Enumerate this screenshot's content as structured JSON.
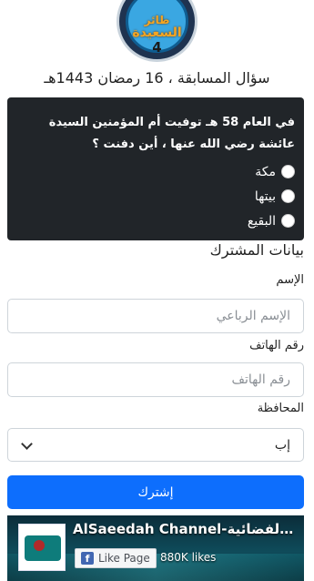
{
  "logo": {
    "line1": "طائر",
    "line2": "السعيدة",
    "line3": "4"
  },
  "header": {
    "question_title": "سؤال المسابقة ، 16 رمضان 1443هـ"
  },
  "question": {
    "text": "في العام 58 هـ توفيت أم المؤمنين السيدة عائشة رضي الله عنها ، أين دفنت ؟",
    "options": [
      "مكة",
      "بيتها",
      "البقيع"
    ]
  },
  "form": {
    "section_title": "بيانات المشترك",
    "name_label": "الإسم",
    "name_placeholder": "الإسم الرباعي",
    "phone_label": "رقم الهاتف",
    "phone_placeholder": "رقم الهاتف",
    "governorate_label": "المحافظة",
    "governorate_value": "إب",
    "submit_label": "إشترك"
  },
  "facebook": {
    "page_name": "AlSaeedah Channel-قناة السعيدة الفضائية",
    "like_label": "Like Page",
    "like_icon": "facebook-f-icon",
    "likes": "880K likes"
  }
}
